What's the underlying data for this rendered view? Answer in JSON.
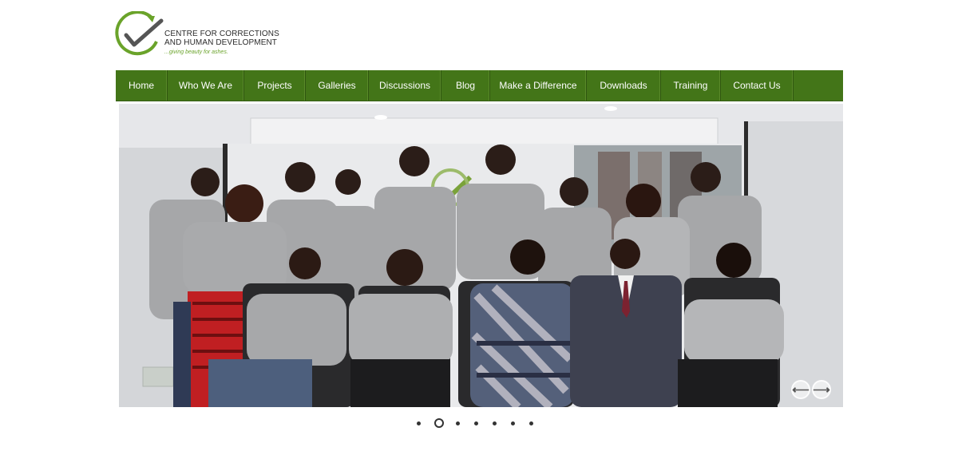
{
  "brand": {
    "line1": "CENTRE FOR CORRECTIONS",
    "line2": "AND HUMAN DEVELOPMENT",
    "tagline": "...giving beauty for ashes.",
    "primary_color": "#437518",
    "accent_color": "#6aa32a"
  },
  "nav": {
    "items": [
      {
        "label": "Home"
      },
      {
        "label": "Who We Are"
      },
      {
        "label": "Projects"
      },
      {
        "label": "Galleries"
      },
      {
        "label": "Discussions"
      },
      {
        "label": "Blog"
      },
      {
        "label": "Make a Difference"
      },
      {
        "label": "Downloads"
      },
      {
        "label": "Training"
      },
      {
        "label": "Contact Us"
      }
    ]
  },
  "slider": {
    "prev_icon": "arrow-left-icon",
    "next_icon": "arrow-right-icon",
    "slide_count": 7,
    "active_slide": 2,
    "prev_glyph": "⟵",
    "next_glyph": "⟶"
  }
}
